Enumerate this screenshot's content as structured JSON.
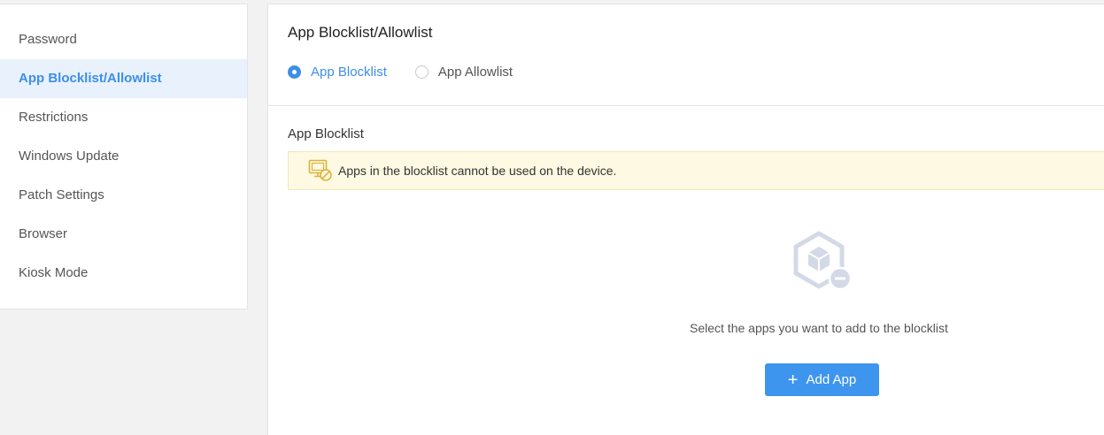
{
  "sidebar": {
    "items": [
      {
        "label": "Password"
      },
      {
        "label": "App Blocklist/Allowlist",
        "active": true
      },
      {
        "label": "Restrictions"
      },
      {
        "label": "Windows Update"
      },
      {
        "label": "Patch Settings"
      },
      {
        "label": "Browser"
      },
      {
        "label": "Kiosk Mode"
      }
    ]
  },
  "main": {
    "title": "App Blocklist/Allowlist",
    "radios": [
      {
        "label": "App Blocklist",
        "checked": true
      },
      {
        "label": "App Allowlist",
        "checked": false
      }
    ],
    "section_title": "App Blocklist",
    "notice": "Apps in the blocklist cannot be used on the device.",
    "empty_text": "Select the apps you want to add to the blocklist",
    "add_button": "Add App",
    "add_button_icon": "plus-icon",
    "notice_icon": "monitor-blocked-icon",
    "empty_icon": "app-package-remove-icon"
  },
  "colors": {
    "accent": "#3d8fe6",
    "notice_bg": "#fdf9e3",
    "notice_icon": "#e0b23a",
    "button": "#3d95ee"
  }
}
